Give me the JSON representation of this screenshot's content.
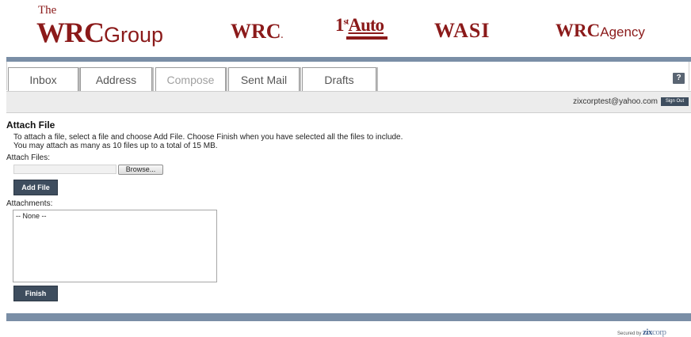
{
  "brand_color": "#8b1a1a",
  "accent_color": "#3e4d5e",
  "bar_color": "#7a8ea6",
  "logos": {
    "wrc_group": {
      "the": "The",
      "wrc": "WRC",
      "group": "Group"
    },
    "wrc": {
      "text": "WRC",
      "mark": "."
    },
    "first_auto": {
      "text": "1",
      "sup": "st",
      "auto": "Auto"
    },
    "wasi": {
      "text": "WASI"
    },
    "wrc_agency": {
      "wrc": "WRC",
      "agency": "Agency"
    }
  },
  "tabs": [
    {
      "label": "Inbox",
      "active": false
    },
    {
      "label": "Address",
      "active": false
    },
    {
      "label": "Compose",
      "active": true
    },
    {
      "label": "Sent Mail",
      "active": false
    },
    {
      "label": "Drafts",
      "active": false
    }
  ],
  "help_label": "?",
  "user": {
    "email": "zixcorptest@yahoo.com",
    "sign_out_label": "Sign Out"
  },
  "attach": {
    "heading": "Attach File",
    "instruction_1": "To attach a file, select a file and choose Add File. Choose Finish when you have selected all the files to include.",
    "instruction_2": "You may attach as many as 10 files up to a total of 15 MB.",
    "files_label": "Attach Files:",
    "file_value": "",
    "browse_label": "Browse...",
    "add_file_label": "Add File",
    "attachments_label": "Attachments:",
    "attachments": [
      "-- None --"
    ],
    "finish_label": "Finish"
  },
  "footer": {
    "secured_by": "Secured by",
    "zix": "zix",
    "corp": "corp"
  }
}
